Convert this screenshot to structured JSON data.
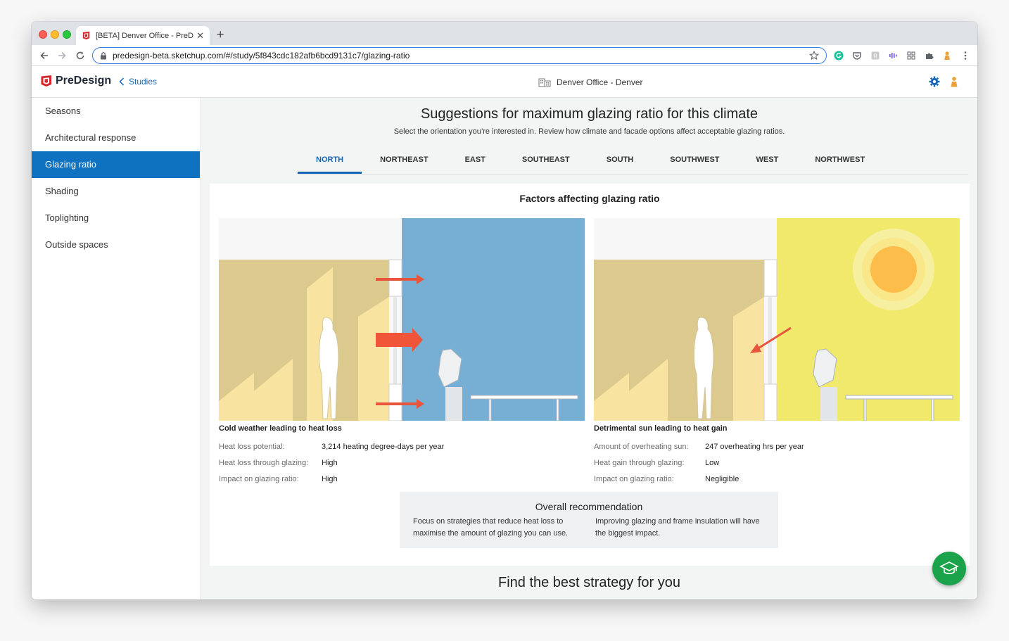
{
  "browser": {
    "tab_title": "[BETA] Denver Office - PreDes",
    "url": "predesign-beta.sketchup.com/#/study/5f843cdc182afb6bcd9131c7/glazing-ratio",
    "new_tab_symbol": "+",
    "close_symbol": "✕"
  },
  "header": {
    "app_name": "PreDesign",
    "back_label": "Studies",
    "project_name": "Denver Office - Denver"
  },
  "sidebar": {
    "items": [
      {
        "label": "Seasons"
      },
      {
        "label": "Architectural response"
      },
      {
        "label": "Glazing ratio"
      },
      {
        "label": "Shading"
      },
      {
        "label": "Toplighting"
      },
      {
        "label": "Outside spaces"
      }
    ]
  },
  "main": {
    "title": "Suggestions for maximum glazing ratio for this climate",
    "subtitle": "Select the orientation you’re interested in. Review how climate and facade options affect acceptable glazing ratios.",
    "orientations": [
      "NORTH",
      "NORTHEAST",
      "EAST",
      "SOUTHEAST",
      "SOUTH",
      "SOUTHWEST",
      "WEST",
      "NORTHWEST"
    ],
    "card_title": "Factors affecting glazing ratio",
    "heat_loss": {
      "title": "Cold weather leading to heat loss",
      "rows": [
        {
          "label": "Heat loss potential:",
          "value": "3,214 heating degree-days per year"
        },
        {
          "label": "Heat loss through glazing:",
          "value": "High"
        },
        {
          "label": "Impact on glazing ratio:",
          "value": "High"
        }
      ]
    },
    "heat_gain": {
      "title": "Detrimental sun leading to heat gain",
      "rows": [
        {
          "label": "Amount of overheating sun:",
          "value": "247 overheating hrs per year"
        },
        {
          "label": "Heat gain through glazing:",
          "value": "Low"
        },
        {
          "label": "Impact on glazing ratio:",
          "value": "Negligible"
        }
      ]
    },
    "recommendation": {
      "title": "Overall recommendation",
      "text1": "Focus on strategies that reduce heat loss to maximise the amount of glazing you can use.",
      "text2": "Improving glazing and frame insulation will have the biggest impact."
    },
    "bottom_title": "Find the best strategy for you"
  },
  "colors": {
    "accent": "#1668b7",
    "sidebar_active": "#0f72c1",
    "interior_wall": "#dcc98e",
    "cold_sky": "#77aed3",
    "warm_sky": "#f0e96b",
    "sun": "#fdbd4a",
    "arrow": "#f0553a",
    "fab": "#1aa34a"
  },
  "icons": {
    "back": "chevron-left-icon",
    "building": "building-icon",
    "settings": "gear-icon",
    "avatar": "user-avatar-icon",
    "fab": "graduation-cap-icon",
    "lock": "lock-icon",
    "star": "star-icon"
  }
}
